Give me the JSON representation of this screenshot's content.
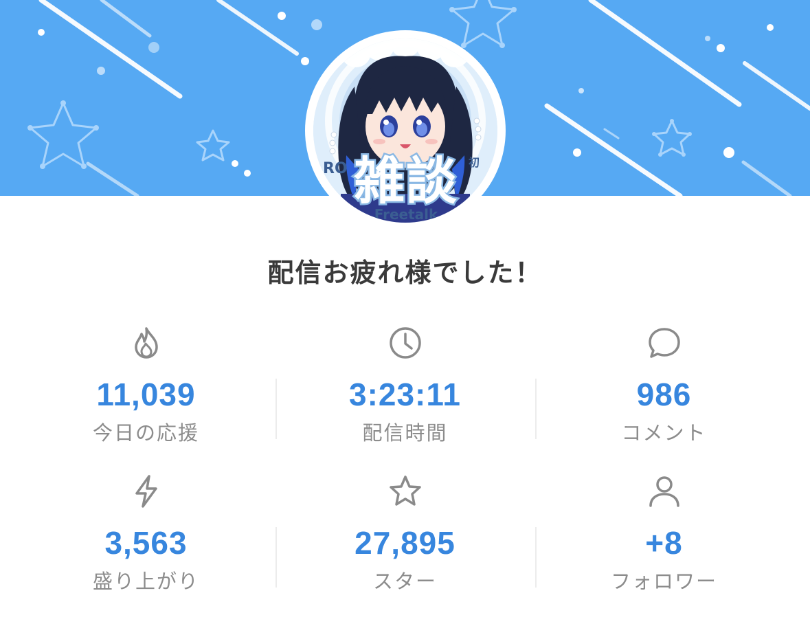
{
  "headline": "配信お疲れ様でした！",
  "avatar": {
    "title_text": "雑談",
    "subtitle_text": "Freetalk"
  },
  "colors": {
    "banner": "#56a9f3",
    "accent": "#3786de",
    "label": "#8c8c8c",
    "headline": "#3a3a3a"
  },
  "stats": [
    {
      "icon": "flame-icon",
      "value": "11,039",
      "label": "今日の応援"
    },
    {
      "icon": "clock-icon",
      "value": "3:23:11",
      "label": "配信時間"
    },
    {
      "icon": "comment-icon",
      "value": "986",
      "label": "コメント"
    },
    {
      "icon": "lightning-icon",
      "value": "3,563",
      "label": "盛り上がり"
    },
    {
      "icon": "star-icon",
      "value": "27,895",
      "label": "スター"
    },
    {
      "icon": "person-icon",
      "value": "+8",
      "label": "フォロワー"
    }
  ]
}
